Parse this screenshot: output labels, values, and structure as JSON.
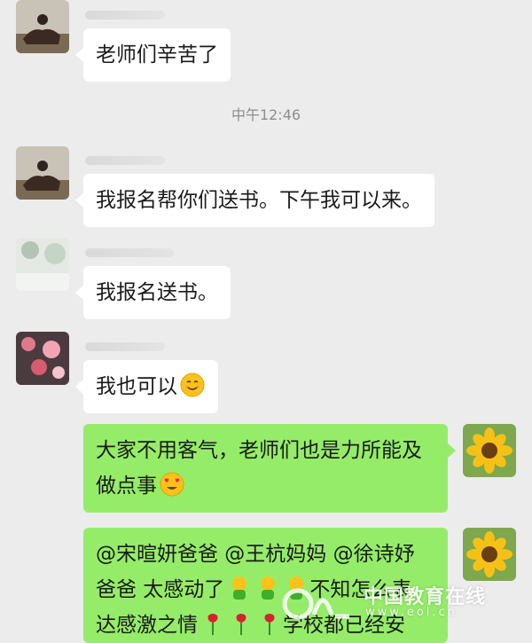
{
  "chat": {
    "messages": [
      {
        "side": "left",
        "text": "老师们辛苦了"
      },
      {
        "side": "left",
        "text": "我报名帮你们送书。下午我可以来。"
      },
      {
        "side": "left",
        "text": "我报名送书。"
      },
      {
        "side": "left",
        "text": "我也可以",
        "emoji": "smiling-face-icon"
      },
      {
        "side": "right",
        "text": "大家不用客气，老师们也是力所能及做点事",
        "emoji": "heart-eyes-face-icon"
      },
      {
        "side": "right",
        "text_line1": "@宋暄妍爸爸 @王杭妈妈 @徐诗妤",
        "text_line2": "爸爸 太感动了",
        "text_line2b": "不知怎么表",
        "text_line3": "达感激之情",
        "text_line3b": "学校都已经安"
      }
    ],
    "timestamp": "中午12:46"
  },
  "watermark": {
    "title": "中国教育在线",
    "url": "www.eol.cn"
  },
  "colors": {
    "background": "#ececec",
    "incoming_bubble": "#ffffff",
    "outgoing_bubble": "#95ec69"
  }
}
